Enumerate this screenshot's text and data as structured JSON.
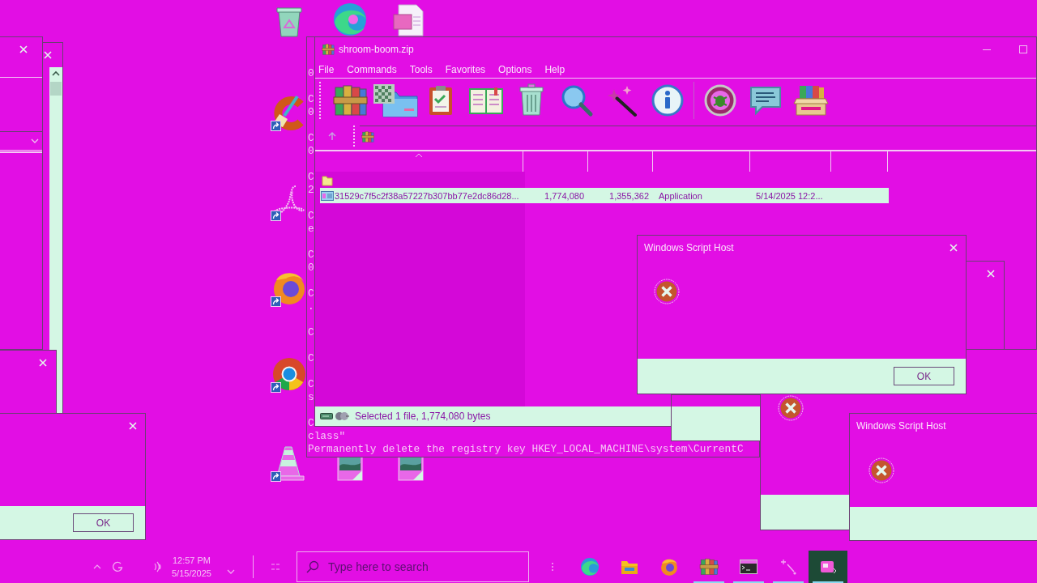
{
  "archive_window": {
    "title": "shroom-boom.zip",
    "menu": [
      "File",
      "Commands",
      "Tools",
      "Favorites",
      "Options",
      "Help"
    ],
    "rows": [
      {
        "kind": "folder",
        "selected": false
      },
      {
        "kind": "file",
        "selected": true,
        "cells": [
          "31529c7f5c2f38a57227b307bb77e2dc86d28...",
          "1,774,080",
          "1,355,362",
          "Application",
          "5/14/2025 12:2..."
        ]
      }
    ],
    "status": "Selected 1 file, 1,774,080 bytes"
  },
  "console": {
    "blocks": [
      {
        "lines": [
          "0"
        ]
      },
      {
        "lines": [
          "C",
          "0"
        ]
      },
      {
        "lines": [
          "C",
          "0"
        ]
      },
      {
        "lines": [
          "C",
          "2"
        ]
      },
      {
        "lines": [
          "C",
          "e"
        ]
      },
      {
        "lines": [
          "C",
          "0"
        ]
      },
      {
        "lines": [
          "C",
          "."
        ]
      },
      {
        "lines": [
          "C"
        ]
      },
      {
        "lines": [
          "C"
        ]
      },
      {
        "lines": [
          "C",
          "s"
        ]
      },
      {
        "lines": [
          "C",
          "class\"",
          "Permanently delete the registry key HKEY_LOCAL_MACHINE\\system\\CurrentC"
        ]
      }
    ]
  },
  "message_boxes": [
    {
      "title": "Windows Script Host",
      "button": "OK"
    },
    {
      "button": "OK"
    },
    {
      "title": "Windows Script Host"
    }
  ],
  "taskbar": {
    "clock": {
      "time": "12:57 PM",
      "date": "5/15/2025"
    },
    "search": {
      "placeholder": "Type here to search"
    },
    "apps": [
      {
        "kind": "swirl",
        "running": false,
        "selected": false
      },
      {
        "kind": "folder",
        "running": false,
        "selected": false
      },
      {
        "kind": "fox",
        "running": false,
        "selected": false
      },
      {
        "kind": "archive",
        "running": true,
        "selected": false
      },
      {
        "kind": "terminal",
        "running": true,
        "selected": false
      },
      {
        "kind": "wand",
        "running": true,
        "selected": false
      },
      {
        "kind": "app",
        "running": true,
        "selected": true
      }
    ]
  }
}
